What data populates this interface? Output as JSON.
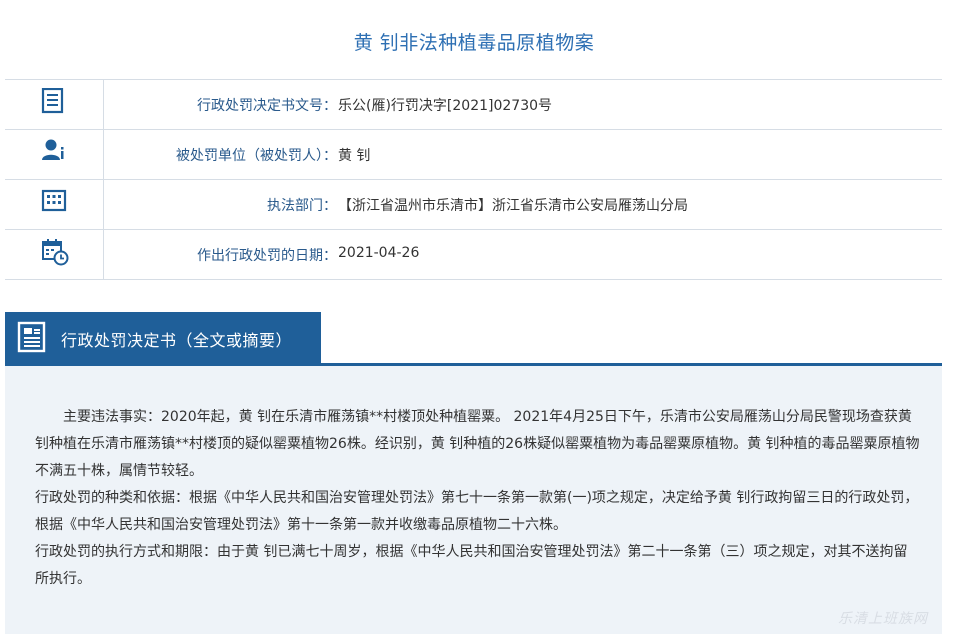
{
  "page": {
    "title": "黄 钊非法种植毒品原植物案"
  },
  "info": [
    {
      "icon": "document-icon",
      "label": "行政处罚决定书文号：",
      "value": "乐公(雁)行罚决字[2021]02730号"
    },
    {
      "icon": "person-icon",
      "label": "被处罚单位（被处罚人）：",
      "value": "黄 钊"
    },
    {
      "icon": "building-icon",
      "label": "执法部门：",
      "value": "【浙江省温州市乐清市】浙江省乐清市公安局雁荡山分局"
    },
    {
      "icon": "calendar-clock-icon",
      "label": "作出行政处罚的日期：",
      "value": "2021-04-26"
    }
  ],
  "section": {
    "title": "行政处罚决定书（全文或摘要）"
  },
  "content": {
    "facts": "主要违法事实：2020年起，黄 钊在乐清市雁荡镇**村楼顶处种植罂粟。 2021年4月25日下午，乐清市公安局雁荡山分局民警现场查获黄 钊种植在乐清市雁荡镇**村楼顶的疑似罂粟植物26株。经识别，黄 钊种植的26株疑似罂粟植物为毒品罂粟原植物。黄 钊种植的毒品罂粟原植物不满五十株，属情节较轻。",
    "basis": "行政处罚的种类和依据：根据《中华人民共和国治安管理处罚法》第七十一条第一款第(一)项之规定，决定给予黄 钊行政拘留三日的行政处罚，根据《中华人民共和国治安管理处罚法》第十一条第一款并收缴毒品原植物二十六株。",
    "execution": "行政处罚的执行方式和期限：由于黄 钊已满七十周岁，根据《中华人民共和国治安管理处罚法》第二十一条第（三）项之规定，对其不送拘留所执行。"
  },
  "colors": {
    "accent": "#1f5f99",
    "title": "#2d6fb3",
    "content_bg": "#eef3f8"
  }
}
